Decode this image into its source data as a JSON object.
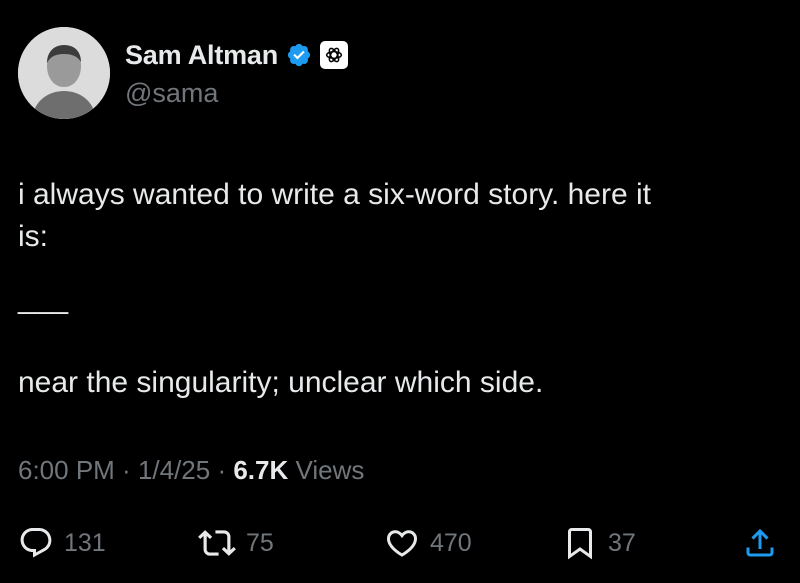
{
  "author": {
    "display_name": "Sam Altman",
    "handle": "@sama",
    "verified_color": "#1d9bf0"
  },
  "tweet": {
    "line1": "i always wanted to write a six-word story. here it",
    "line2": "is:",
    "separator": "___",
    "line3": "near the singularity; unclear which side."
  },
  "meta": {
    "time": "6:00 PM",
    "dot1": " · ",
    "date": "1/4/25",
    "dot2": " · ",
    "views_count": "6.7K",
    "views_label": " Views"
  },
  "actions": {
    "replies": "131",
    "reposts": "75",
    "likes": "470",
    "bookmarks": "37"
  },
  "icons": [
    "verified-icon",
    "openai-icon",
    "reply-icon",
    "repost-icon",
    "like-icon",
    "bookmark-icon",
    "share-icon"
  ]
}
